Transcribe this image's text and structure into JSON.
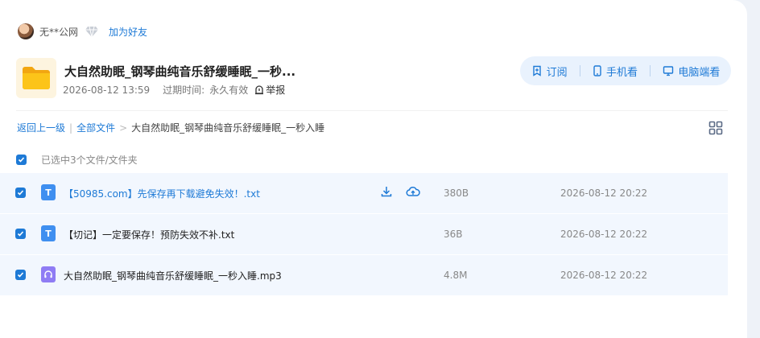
{
  "user": {
    "name": "无**公网",
    "add_friend_label": "加为好友"
  },
  "folder": {
    "title": "大自然助眠_钢琴曲纯音乐舒缓睡眠_一秒...",
    "date": "2026-08-12 13:59",
    "expiry_label": "过期时间:",
    "expiry_value": "永久有效",
    "report_label": "举报"
  },
  "actions": {
    "subscribe": "订阅",
    "mobile": "手机看",
    "desktop": "电脑端看"
  },
  "breadcrumb": {
    "back": "返回上一级",
    "all_files": "全部文件",
    "current": "大自然助眠_钢琴曲纯音乐舒缓睡眠_一秒入睡"
  },
  "selection": {
    "label": "已选中3个文件/文件夹"
  },
  "files": [
    {
      "type": "txt",
      "icon_letter": "T",
      "name": "【50985.com】先保存再下载避免失效！.txt",
      "size": "380B",
      "date": "2026-08-12 20:22"
    },
    {
      "type": "txt",
      "icon_letter": "T",
      "name": "【切记】一定要保存！预防失效不补.txt",
      "size": "36B",
      "date": "2026-08-12 20:22"
    },
    {
      "type": "mp3",
      "icon_letter": "",
      "name": "大自然助眠_钢琴曲纯音乐舒缓睡眠_一秒入睡.mp3",
      "size": "4.8M",
      "date": "2026-08-12 20:22"
    }
  ],
  "colors": {
    "accent": "#1e7ad6",
    "pill_bg": "#e9f2fd",
    "row_bg": "#f2f7fe",
    "folder_yellow": "#f9c21d"
  },
  "icons": {
    "vip": "diamond-icon",
    "folder": "folder-icon",
    "report": "report-icon",
    "subscribe": "bookmark-icon",
    "mobile": "phone-icon",
    "desktop": "monitor-icon",
    "view_toggle": "grid-icon",
    "download": "download-icon",
    "save_cloud": "cloud-upload-icon",
    "audio": "headphones-icon"
  }
}
